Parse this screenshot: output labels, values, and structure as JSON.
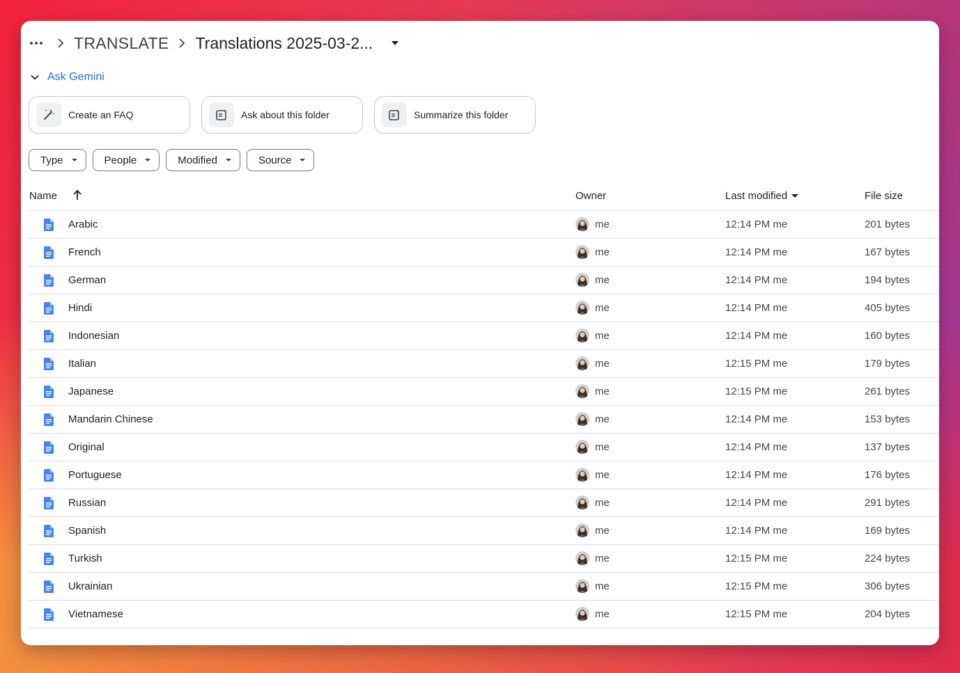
{
  "breadcrumb": {
    "parent": "TRANSLATE",
    "current": "Translations 2025-03-2..."
  },
  "gemini": {
    "label": "Ask Gemini",
    "chips": [
      {
        "label": "Create an FAQ",
        "icon": "magic-pen-icon"
      },
      {
        "label": "Ask about this folder",
        "icon": "folder-sparkle-icon"
      },
      {
        "label": "Summarize this folder",
        "icon": "folder-sparkle-icon"
      }
    ]
  },
  "filters": [
    "Type",
    "People",
    "Modified",
    "Source"
  ],
  "columns": {
    "name": "Name",
    "owner": "Owner",
    "modified": "Last modified",
    "size": "File size"
  },
  "files": [
    {
      "name": "Arabic",
      "owner": "me",
      "modified": "12:14 PM  me",
      "size": "201 bytes"
    },
    {
      "name": "French",
      "owner": "me",
      "modified": "12:14 PM  me",
      "size": "167 bytes"
    },
    {
      "name": "German",
      "owner": "me",
      "modified": "12:14 PM  me",
      "size": "194 bytes"
    },
    {
      "name": "Hindi",
      "owner": "me",
      "modified": "12:14 PM  me",
      "size": "405 bytes"
    },
    {
      "name": "Indonesian",
      "owner": "me",
      "modified": "12:14 PM  me",
      "size": "160 bytes"
    },
    {
      "name": "Italian",
      "owner": "me",
      "modified": "12:15 PM  me",
      "size": "179 bytes"
    },
    {
      "name": "Japanese",
      "owner": "me",
      "modified": "12:15 PM  me",
      "size": "261 bytes"
    },
    {
      "name": "Mandarin Chinese",
      "owner": "me",
      "modified": "12:14 PM  me",
      "size": "153 bytes"
    },
    {
      "name": "Original",
      "owner": "me",
      "modified": "12:14 PM  me",
      "size": "137 bytes"
    },
    {
      "name": "Portuguese",
      "owner": "me",
      "modified": "12:14 PM  me",
      "size": "176 bytes"
    },
    {
      "name": "Russian",
      "owner": "me",
      "modified": "12:14 PM  me",
      "size": "291 bytes"
    },
    {
      "name": "Spanish",
      "owner": "me",
      "modified": "12:14 PM  me",
      "size": "169 bytes"
    },
    {
      "name": "Turkish",
      "owner": "me",
      "modified": "12:15 PM  me",
      "size": "224 bytes"
    },
    {
      "name": "Ukrainian",
      "owner": "me",
      "modified": "12:15 PM  me",
      "size": "306 bytes"
    },
    {
      "name": "Vietnamese",
      "owner": "me",
      "modified": "12:15 PM  me",
      "size": "204 bytes"
    }
  ],
  "colors": {
    "accent": "#1a73e8",
    "doc_icon": "#4285f4",
    "border": "#e0e0e0"
  }
}
